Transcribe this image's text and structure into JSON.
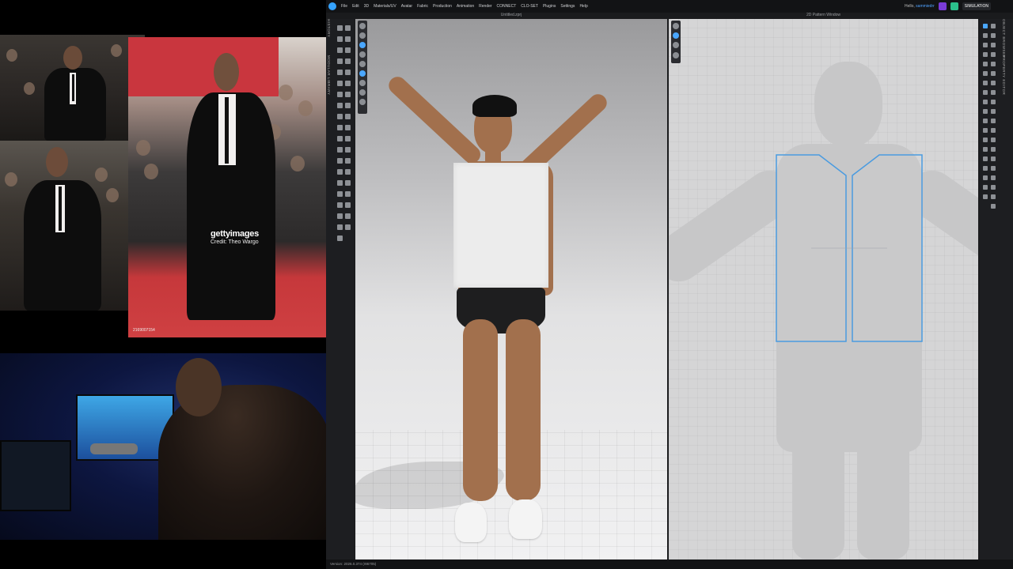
{
  "menubar": {
    "items": [
      "File",
      "Edit",
      "3D",
      "Materials/UV",
      "Avatar",
      "Fabric",
      "Production",
      "Animation",
      "Render",
      "CONNECT",
      "CLO-SET",
      "Plugins",
      "Settings",
      "Help"
    ],
    "greeting_prefix": "Hello, ",
    "username": "sammiedrr",
    "simulation_label": "SIMULATION"
  },
  "windows": {
    "viewport_3d_title": "Untitled.zprj",
    "pattern_window_title": "2D Pattern Window"
  },
  "side_tabs": {
    "left": [
      "HISTORY",
      "MODULAR LIBRARY"
    ],
    "right": [
      "OBJECT BROWSER",
      "PROPERTY EDITOR"
    ]
  },
  "photos": {
    "watermark": "gettyimages",
    "credit": "Credit: Theo Wargo",
    "photo_id": "2169007154"
  },
  "status": {
    "version": "Version: 2026.0.374 (r86705)"
  },
  "colors": {
    "pattern_outline": "#4a9be0",
    "accent": "#35a3ff",
    "app_bg": "#1a1b1d"
  }
}
